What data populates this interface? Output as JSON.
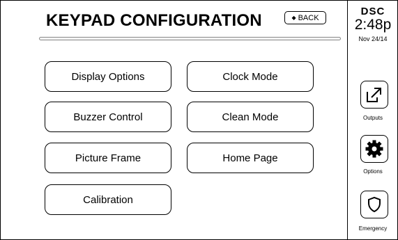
{
  "header": {
    "title": "KEYPAD CONFIGURATION",
    "back_label": "BACK"
  },
  "menu": {
    "display_options": "Display Options",
    "clock_mode": "Clock Mode",
    "buzzer_control": "Buzzer Control",
    "clean_mode": "Clean Mode",
    "picture_frame": "Picture Frame",
    "home_page": "Home Page",
    "calibration": "Calibration"
  },
  "sidebar": {
    "brand": "DSC",
    "time": "2:48p",
    "date": "Nov 24/14",
    "outputs_label": "Outputs",
    "options_label": "Options",
    "emergency_label": "Emergency"
  },
  "icons": {
    "back": "left-arrow-icon",
    "outputs": "external-link-icon",
    "options": "gear-icon",
    "emergency": "shield-icon"
  }
}
